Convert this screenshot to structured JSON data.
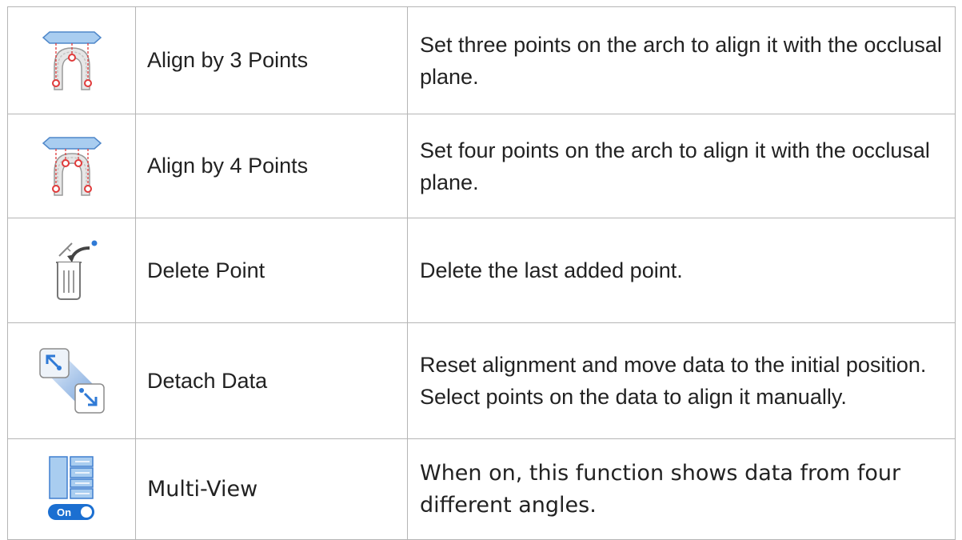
{
  "rows": [
    {
      "icon": "align-3-points-icon",
      "name": "Align by 3 Points",
      "description": "Set three points on the arch to align it with the occlusal plane."
    },
    {
      "icon": "align-4-points-icon",
      "name": "Align by 4 Points",
      "description": "Set four points on the arch to align it with the occlusal plane."
    },
    {
      "icon": "delete-point-icon",
      "name": "Delete Point",
      "description": "Delete the last added point."
    },
    {
      "icon": "detach-data-icon",
      "name": "Detach Data",
      "description": "Reset alignment and move data to the initial position. Select points on the data to align it manually."
    },
    {
      "icon": "multi-view-icon",
      "name": "Multi-View",
      "description": "When on, this function shows data from four different angles.",
      "toggle_label": "On"
    }
  ],
  "colors": {
    "border": "#b5b5b5",
    "plane_blue": "#a9cdf0",
    "point_red": "#e03a3a",
    "accent_blue": "#1b6fd1"
  }
}
